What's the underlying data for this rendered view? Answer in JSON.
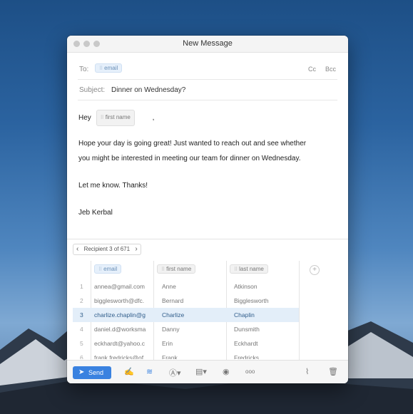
{
  "window": {
    "title": "New Message"
  },
  "to": {
    "label": "To:",
    "chip": "email",
    "cc": "Cc",
    "bcc": "Bcc"
  },
  "subject": {
    "label": "Subject:",
    "value": "Dinner on Wednesday?"
  },
  "message": {
    "greeting": "Hey",
    "greeting_chip": "first name",
    "comma": ",",
    "paragraph1_line1": "Hope your day is going great! Just wanted to reach out and see whether",
    "paragraph1_line2": "you might be interested in meeting our team for dinner on Wednesday.",
    "paragraph2": "Let me know. Thanks!",
    "signature": "Jeb Kerbal"
  },
  "recipient_nav": {
    "prev": "‹",
    "label": "Recipient 3 of 671",
    "next": "›"
  },
  "table": {
    "columns": [
      "email",
      "first name",
      "last name"
    ],
    "add": "+",
    "rows": [
      {
        "num": "1",
        "email": "annea@gmail.com",
        "first": "Anne",
        "last": "Atkinson"
      },
      {
        "num": "2",
        "email": "bigglesworth@dfc.",
        "first": "Bernard",
        "last": "Bigglesworth"
      },
      {
        "num": "3",
        "email": "charlize.chaplin@g",
        "first": "Charlize",
        "last": "Chaplin"
      },
      {
        "num": "4",
        "email": "daniel.d@worksma",
        "first": "Danny",
        "last": "Dunsmith"
      },
      {
        "num": "5",
        "email": "eckhardt@yahoo.c",
        "first": "Erin",
        "last": "Eckhardt"
      },
      {
        "num": "6",
        "email": "frank.fredricks@of",
        "first": "Frank",
        "last": "Fredricks"
      }
    ],
    "selected_row": 3
  },
  "toolbar": {
    "send": "Send",
    "icons": [
      "send-icon",
      "signature-icon",
      "layers-icon",
      "translate-icon",
      "document-icon",
      "eye-icon",
      "more-icon",
      "paperclip-icon",
      "trash-icon"
    ],
    "more": "ooo"
  },
  "colors": {
    "accent": "#3a82e0",
    "chip_bg": "#e6f0fb",
    "selected_row": "#e3eef9"
  }
}
